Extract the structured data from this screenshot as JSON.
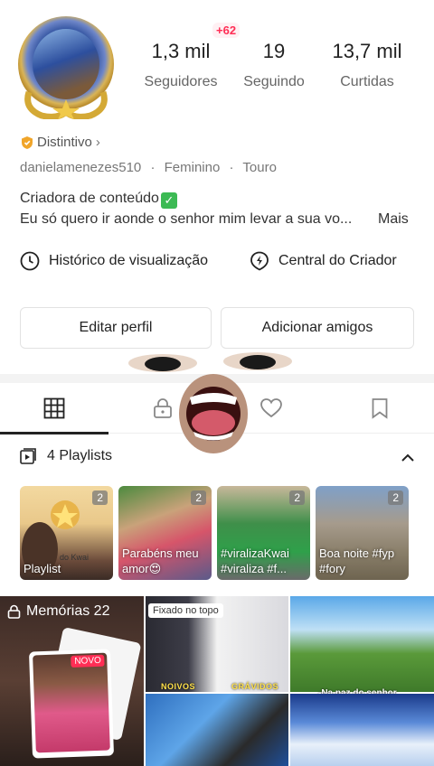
{
  "profile": {
    "notification_badge": "+62",
    "stats": [
      {
        "value": "1,3 mil",
        "label": "Seguidores"
      },
      {
        "value": "19",
        "label": "Seguindo"
      },
      {
        "value": "13,7 mil",
        "label": "Curtidas"
      }
    ],
    "badge_label": "Distintivo",
    "username": "danielamenezes510",
    "gender": "Feminino",
    "sign": "Touro",
    "meta_separator": "·",
    "bio_line1": "Criadora de conteúdo",
    "bio_line2": "Eu só quero ir aonde o senhor mim levar a sua vo...",
    "more_label": "Mais"
  },
  "quick_links": {
    "history": "Histórico de visualização",
    "creator": "Central do Criador"
  },
  "actions": {
    "edit": "Editar perfil",
    "add_friends": "Adicionar amigos"
  },
  "tabs": [
    "grid-icon",
    "lock-icon",
    "heart-icon",
    "bookmark-icon"
  ],
  "playlists": {
    "header": "4 Playlists",
    "items": [
      {
        "count": "2",
        "caption": "Playlist",
        "inner_text": "do Kwai"
      },
      {
        "count": "2",
        "caption": "Parabéns meu amor😍"
      },
      {
        "count": "2",
        "caption": "#viralizaKwai #viraliza #f..."
      },
      {
        "count": "2",
        "caption": "Boa noite #fyp #fory"
      }
    ]
  },
  "grid": {
    "memories_label": "Memórias 22",
    "new_label": "NOVO",
    "pinned_label": "Fixado no topo",
    "overlay_noivos": "NOIVOS",
    "overlay_gravidos": "GRÁVIDOS",
    "overlay_paz": "-Na paz do senhor"
  }
}
